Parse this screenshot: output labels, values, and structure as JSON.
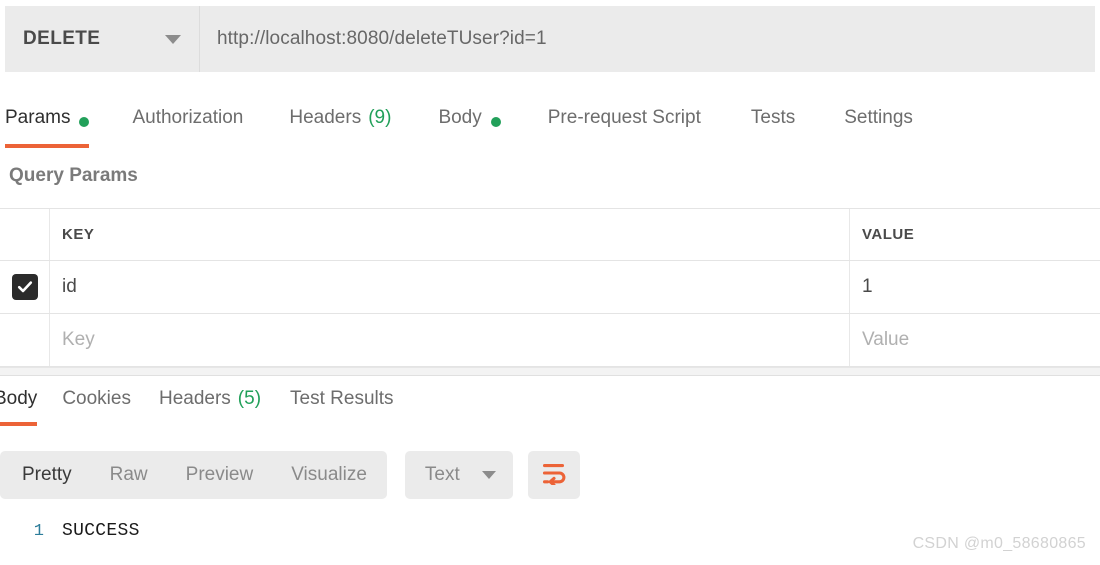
{
  "request": {
    "method": "DELETE",
    "url": "http://localhost:8080/deleteTUser?id=1",
    "tabs": [
      {
        "label": "Params",
        "dot": true,
        "count": "",
        "active": true
      },
      {
        "label": "Authorization",
        "dot": false,
        "count": "",
        "active": false
      },
      {
        "label": "Headers",
        "dot": false,
        "count": "(9)",
        "active": false
      },
      {
        "label": "Body",
        "dot": true,
        "count": "",
        "active": false
      },
      {
        "label": "Pre-request Script",
        "dot": false,
        "count": "",
        "active": false
      },
      {
        "label": "Tests",
        "dot": false,
        "count": "",
        "active": false
      },
      {
        "label": "Settings",
        "dot": false,
        "count": "",
        "active": false
      }
    ]
  },
  "query_params": {
    "section_title": "Query Params",
    "columns": {
      "key": "KEY",
      "value": "VALUE"
    },
    "rows": [
      {
        "checked": true,
        "key": "id",
        "value": "1",
        "key_placeholder": "",
        "value_placeholder": ""
      },
      {
        "checked": false,
        "key": "",
        "value": "",
        "key_placeholder": "Key",
        "value_placeholder": "Value"
      }
    ]
  },
  "response": {
    "tabs": [
      {
        "label": "Body",
        "count": "",
        "active": true
      },
      {
        "label": "Cookies",
        "count": "",
        "active": false
      },
      {
        "label": "Headers",
        "count": "(5)",
        "active": false
      },
      {
        "label": "Test Results",
        "count": "",
        "active": false
      }
    ],
    "format_modes": [
      {
        "label": "Pretty",
        "active": true
      },
      {
        "label": "Raw",
        "active": false
      },
      {
        "label": "Preview",
        "active": false
      },
      {
        "label": "Visualize",
        "active": false
      }
    ],
    "content_type": "Text",
    "wrap_icon": "word-wrap-icon",
    "body_lines": [
      {
        "number": "1",
        "text": "SUCCESS"
      }
    ]
  },
  "watermark": "CSDN @m0_58680865",
  "colors": {
    "accent": "#ec6337",
    "success": "#22a05a",
    "toolbar_bg": "#ebebeb",
    "gutter": "#2d7d9a"
  }
}
